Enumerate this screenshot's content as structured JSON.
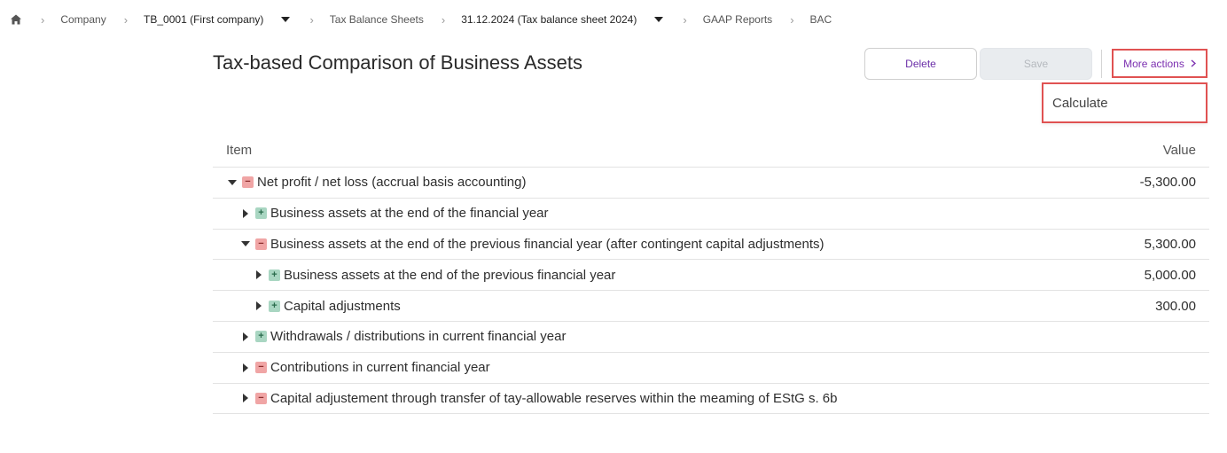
{
  "breadcrumb": {
    "items": [
      {
        "label": "Company"
      },
      {
        "label": "TB_0001 (First company)"
      },
      {
        "label": "Tax Balance Sheets"
      },
      {
        "label": "31.12.2024 (Tax balance sheet 2024)"
      },
      {
        "label": "GAAP Reports"
      },
      {
        "label": "BAC"
      }
    ]
  },
  "page": {
    "title": "Tax-based Comparison of Business Assets"
  },
  "actions": {
    "delete_label": "Delete",
    "save_label": "Save",
    "more_label": "More actions",
    "menu_calculate": "Calculate"
  },
  "table": {
    "header_item": "Item",
    "header_value": "Value",
    "rows": [
      {
        "label": "Net profit / net loss (accrual basis accounting)",
        "value": "-5,300.00",
        "sign": "minus",
        "expanded": true,
        "level": 0
      },
      {
        "label": "Business assets at the end of the financial year",
        "value": "",
        "sign": "plus",
        "expanded": false,
        "level": 1
      },
      {
        "label": "Business assets at the end of the previous financial year (after contingent capital adjustments)",
        "value": "5,300.00",
        "sign": "minus",
        "expanded": true,
        "level": 1
      },
      {
        "label": "Business assets at the end of the previous financial year",
        "value": "5,000.00",
        "sign": "plus",
        "expanded": false,
        "level": 2
      },
      {
        "label": "Capital adjustments",
        "value": "300.00",
        "sign": "plus",
        "expanded": false,
        "level": 2
      },
      {
        "label": "Withdrawals / distributions in current financial year",
        "value": "",
        "sign": "plus",
        "expanded": false,
        "level": 1
      },
      {
        "label": "Contributions in current financial year",
        "value": "",
        "sign": "minus",
        "expanded": false,
        "level": 1
      },
      {
        "label": "Capital adjustement through transfer of tay-allowable reserves within the meaming of EStG s. 6b",
        "value": "",
        "sign": "minus",
        "expanded": false,
        "level": 1
      }
    ]
  },
  "colors": {
    "accent": "#7b2fb0",
    "highlight_border": "#e05252",
    "minus_badge": "#f0a5a5",
    "plus_badge": "#a9d6c2"
  }
}
